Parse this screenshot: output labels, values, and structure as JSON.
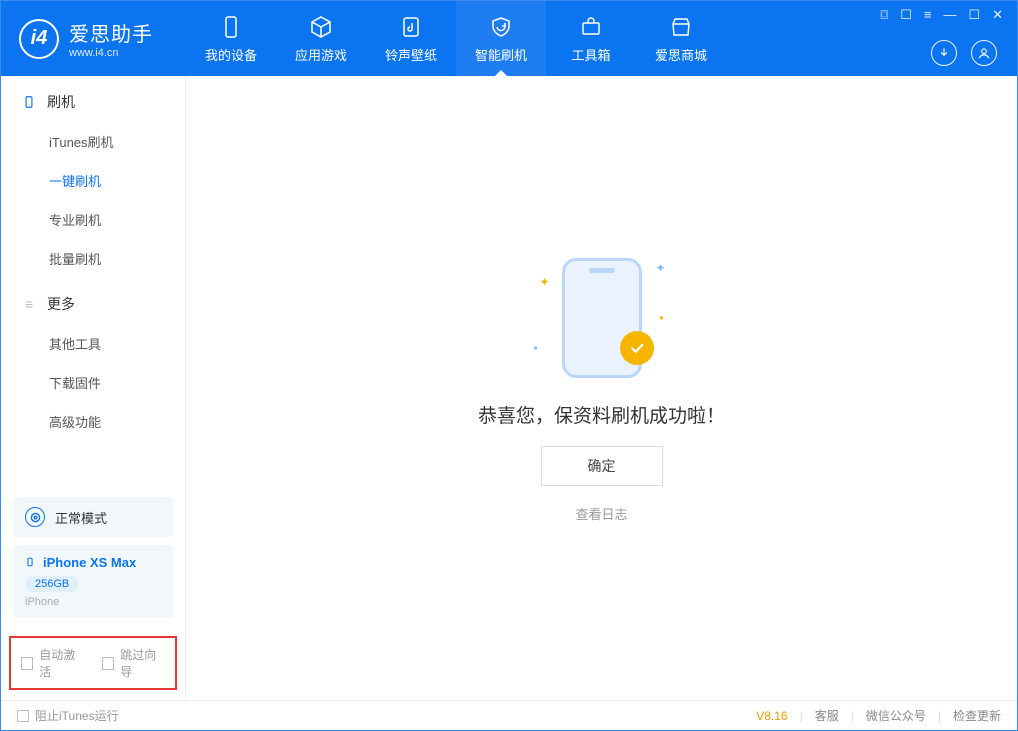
{
  "app": {
    "name_cn": "爱思助手",
    "name_en": "www.i4.cn"
  },
  "nav": {
    "items": [
      {
        "label": "我的设备"
      },
      {
        "label": "应用游戏"
      },
      {
        "label": "铃声壁纸"
      },
      {
        "label": "智能刷机"
      },
      {
        "label": "工具箱"
      },
      {
        "label": "爱思商城"
      }
    ]
  },
  "sidebar": {
    "group1_title": "刷机",
    "group1_items": [
      "iTunes刷机",
      "一键刷机",
      "专业刷机",
      "批量刷机"
    ],
    "group2_title": "更多",
    "group2_items": [
      "其他工具",
      "下载固件",
      "高级功能"
    ]
  },
  "mode_card": {
    "label": "正常模式"
  },
  "device": {
    "name": "iPhone XS Max",
    "storage": "256GB",
    "type": "iPhone"
  },
  "checks": {
    "auto_activate": "自动激活",
    "skip_guide": "跳过向导"
  },
  "main": {
    "success_text": "恭喜您，保资料刷机成功啦！",
    "ok_button": "确定",
    "log_link": "查看日志"
  },
  "footer": {
    "block_itunes": "阻止iTunes运行",
    "version": "V8.16",
    "links": [
      "客服",
      "微信公众号",
      "检查更新"
    ]
  }
}
